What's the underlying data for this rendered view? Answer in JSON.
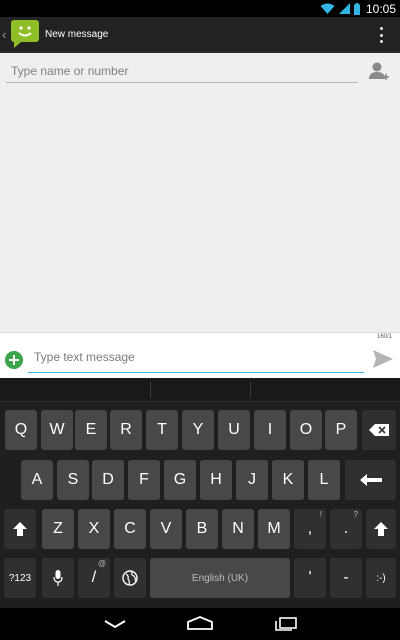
{
  "status_bar": {
    "time": "10:05",
    "icons": [
      "wifi-icon",
      "signal-icon",
      "battery-icon"
    ]
  },
  "action_bar": {
    "title": "New message",
    "icons": [
      "messaging-app-icon",
      "overflow-menu-icon"
    ]
  },
  "recipient": {
    "placeholder": "Type name or number",
    "contact_icon": "add-contact-icon"
  },
  "compose": {
    "char_counter": "160/1",
    "placeholder": "Type text message",
    "attach_icon": "attach-plus-icon",
    "send_icon": "send-icon"
  },
  "keyboard": {
    "row1": [
      "Q",
      "W",
      "E",
      "R",
      "T",
      "Y",
      "U",
      "I",
      "O",
      "P"
    ],
    "row2": [
      "A",
      "S",
      "D",
      "F",
      "G",
      "H",
      "J",
      "K",
      "L"
    ],
    "row3": [
      "Z",
      "X",
      "C",
      "V",
      "B",
      "N",
      "M"
    ],
    "row3_punct": [
      ",",
      "."
    ],
    "row3_punct_alt": [
      "!",
      "?"
    ],
    "row4": {
      "symbols": "?123",
      "slash": "/",
      "slash_alt": "@",
      "space": "English (UK)",
      "apostrophe": "'",
      "dash": "-",
      "smiley": ":-)"
    },
    "icons": [
      "backspace-icon",
      "enter-icon",
      "shift-icon",
      "microphone-icon",
      "globe-icon"
    ]
  },
  "nav_bar": {
    "icons": [
      "back-icon",
      "home-icon",
      "recents-icon"
    ]
  },
  "colors": {
    "accent": "#33b5e5",
    "attach": "#3aa54b",
    "app_icon": "#8fbf26"
  }
}
